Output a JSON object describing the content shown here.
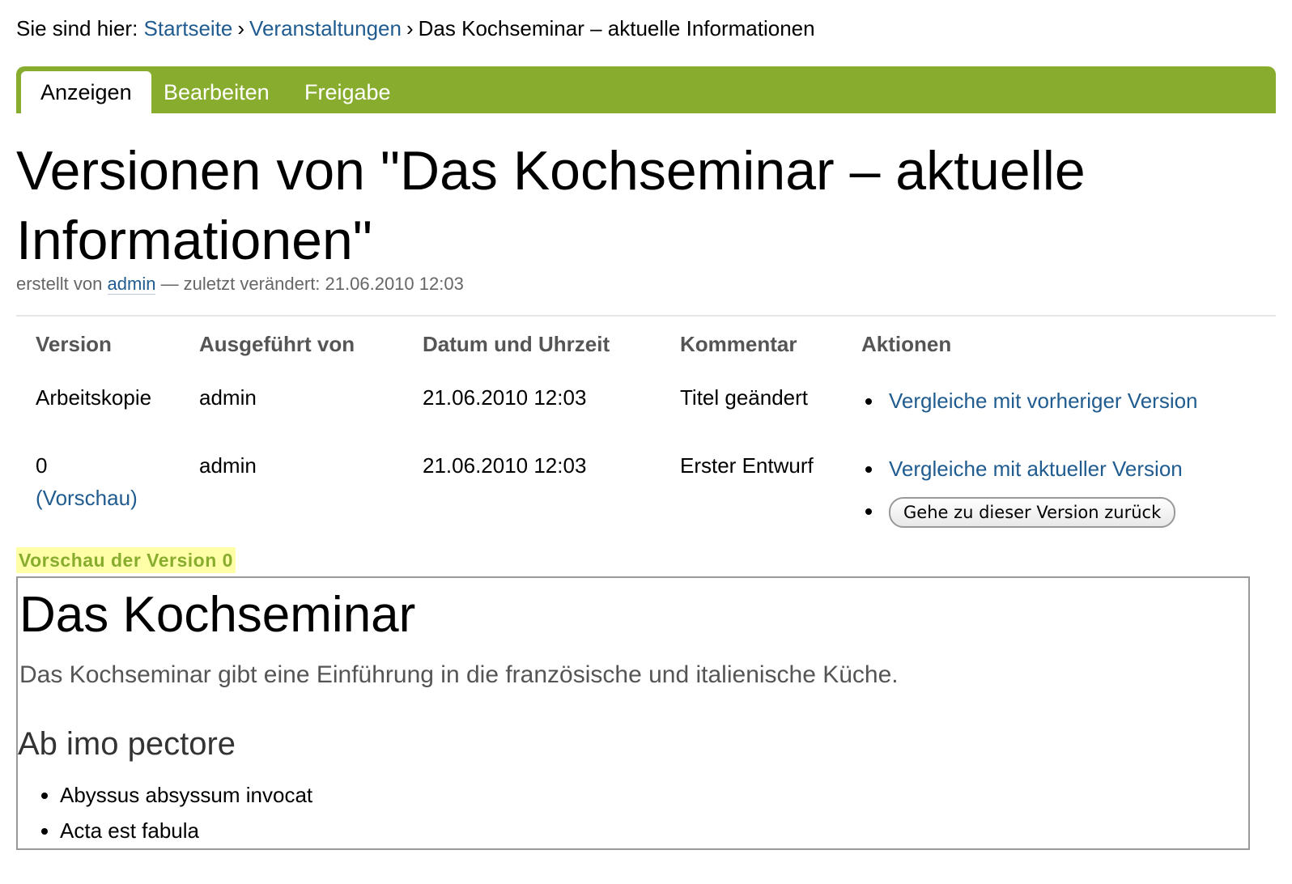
{
  "breadcrumbs": {
    "prefix": "Sie sind hier:",
    "items": [
      "Startseite",
      "Veranstaltungen",
      "Das Kochseminar – aktuelle Informationen"
    ],
    "separator": "›"
  },
  "tabs": [
    "Anzeigen",
    "Bearbeiten",
    "Freigabe"
  ],
  "page": {
    "title": "Versionen von \"Das Kochseminar – aktuelle Informationen\"",
    "byline_prefix": "erstellt von",
    "byline_author": "admin",
    "byline_suffix": "— zuletzt verändert: 21.06.2010 12:03"
  },
  "versions_table": {
    "headers": [
      "Version",
      "Ausgeführt von",
      "Datum und Uhrzeit",
      "Kommentar",
      "Aktionen"
    ],
    "rows": [
      {
        "version": "Arbeitskopie",
        "preview_link": "",
        "author": "admin",
        "date": "21.06.2010 12:03",
        "comment": "Titel geändert",
        "action_link": "Vergleiche mit vorheriger Version",
        "action_button": ""
      },
      {
        "version": "0",
        "preview_link": "(Vorschau)",
        "author": "admin",
        "date": "21.06.2010 12:03",
        "comment": "Erster Entwurf",
        "action_link": "Vergleiche mit aktueller Version",
        "action_button": "Gehe zu dieser Version zurück"
      }
    ]
  },
  "preview": {
    "heading": "Vorschau der Version 0",
    "title": "Das Kochseminar",
    "lead": "Das Kochseminar gibt eine Einführung in die französische und italienische Küche.",
    "subheading": "Ab imo pectore",
    "list": [
      "Abyssus absyssum invocat",
      "Acta est fabula"
    ]
  },
  "colors": {
    "accent_green": "#88ad2e",
    "link_blue": "#205c90",
    "highlight_yellow": "#ffffa8"
  }
}
